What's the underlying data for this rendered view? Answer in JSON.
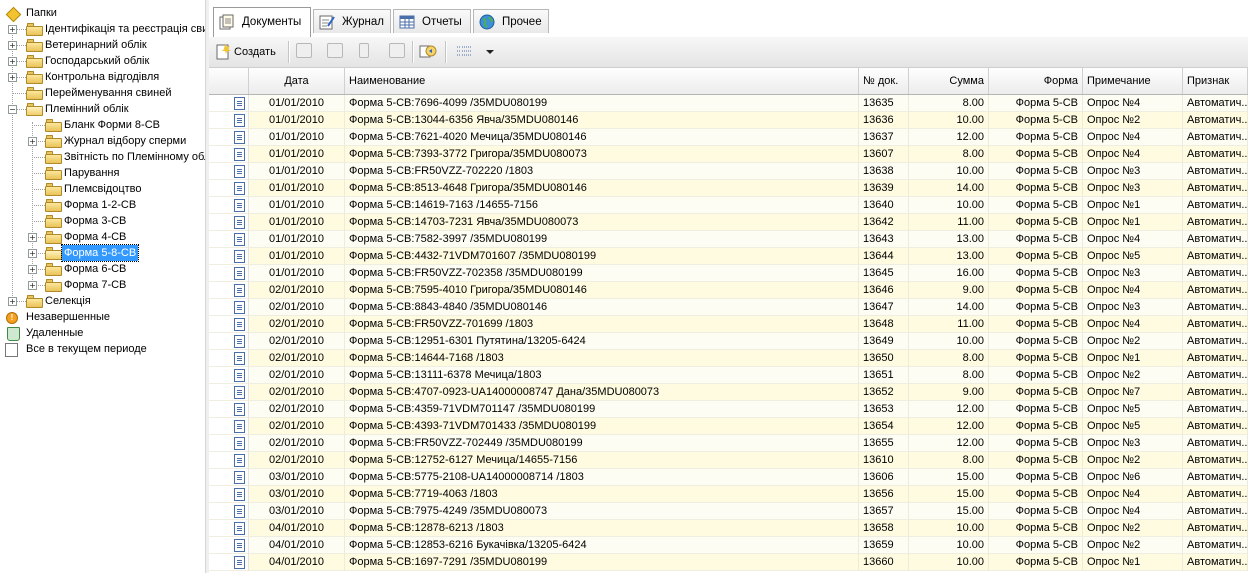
{
  "tree": {
    "root": "Папки",
    "items": [
      {
        "label": "Ідентифікація та реєстрація свиней",
        "level": 1,
        "exp": "+"
      },
      {
        "label": "Ветеринарний облік",
        "level": 1,
        "exp": "+"
      },
      {
        "label": "Господарський облік",
        "level": 1,
        "exp": "+"
      },
      {
        "label": "Контрольна відгодівля",
        "level": 1,
        "exp": "+"
      },
      {
        "label": "Перейменування свиней",
        "level": 1,
        "exp": ""
      },
      {
        "label": "Племінний облік",
        "level": 1,
        "exp": "-"
      },
      {
        "label": "Бланк Форми 8-СВ",
        "level": 2,
        "exp": ""
      },
      {
        "label": "Журнал відбору сперми",
        "level": 2,
        "exp": "+"
      },
      {
        "label": "Звітність по Племінному облік",
        "level": 2,
        "exp": ""
      },
      {
        "label": "Парування",
        "level": 2,
        "exp": ""
      },
      {
        "label": "Племсвідоцтво",
        "level": 2,
        "exp": ""
      },
      {
        "label": "Форма 1-2-СВ",
        "level": 2,
        "exp": ""
      },
      {
        "label": "Форма 3-СВ",
        "level": 2,
        "exp": ""
      },
      {
        "label": "Форма 4-СВ",
        "level": 2,
        "exp": "+"
      },
      {
        "label": "Форма 5-8-СВ",
        "level": 2,
        "exp": "+",
        "selected": true
      },
      {
        "label": "Форма 6-СВ",
        "level": 2,
        "exp": "+"
      },
      {
        "label": "Форма 7-СВ",
        "level": 2,
        "exp": "+"
      },
      {
        "label": "Селекція",
        "level": 1,
        "exp": "+"
      }
    ],
    "special": [
      {
        "label": "Незавершенные",
        "icon": "warning-icon"
      },
      {
        "label": "Удаленные",
        "icon": "recycle-bin-icon"
      },
      {
        "label": "Все в текущем периоде",
        "icon": "all-documents-icon"
      }
    ]
  },
  "tabs": [
    {
      "label": "Документы",
      "icon": "documents-icon",
      "active": true
    },
    {
      "label": "Журнал",
      "icon": "journal-icon",
      "active": false
    },
    {
      "label": "Отчеты",
      "icon": "reports-icon",
      "active": false
    },
    {
      "label": "Прочее",
      "icon": "globe-icon",
      "active": false
    }
  ],
  "toolbar": {
    "create_label": "Создать"
  },
  "grid": {
    "columns": [
      "",
      "Дата",
      "Наименование",
      "№ док.",
      "Сумма",
      "Форма",
      "Примечание",
      "Признак"
    ],
    "rows": [
      [
        "01/01/2010",
        "Форма 5-СВ:7696-4099      /35MDU080199",
        "13635",
        "8.00",
        "Форма 5-СВ",
        "Опрос №4",
        "Автоматич..."
      ],
      [
        "01/01/2010",
        "Форма 5-СВ:13044-6356 Явча/35MDU080146",
        "13636",
        "10.00",
        "Форма 5-СВ",
        "Опрос №2",
        "Автоматич..."
      ],
      [
        "01/01/2010",
        "Форма 5-СВ:7621-4020 Мечица/35MDU080146",
        "13637",
        "12.00",
        "Форма 5-СВ",
        "Опрос №4",
        "Автоматич..."
      ],
      [
        "01/01/2010",
        "Форма 5-СВ:7393-3772 Григора/35MDU080073",
        "13607",
        "8.00",
        "Форма 5-СВ",
        "Опрос №4",
        "Автоматич..."
      ],
      [
        "01/01/2010",
        "Форма 5-СВ:FR50VZZ-702220  /1803",
        "13638",
        "10.00",
        "Форма 5-СВ",
        "Опрос №3",
        "Автоматич..."
      ],
      [
        "01/01/2010",
        "Форма 5-СВ:8513-4648 Григора/35MDU080146",
        "13639",
        "14.00",
        "Форма 5-СВ",
        "Опрос №3",
        "Автоматич..."
      ],
      [
        "01/01/2010",
        "Форма 5-СВ:14619-7163      /14655-7156",
        "13640",
        "10.00",
        "Форма 5-СВ",
        "Опрос №1",
        "Автоматич..."
      ],
      [
        "01/01/2010",
        "Форма 5-СВ:14703-7231 Явча/35MDU080073",
        "13642",
        "11.00",
        "Форма 5-СВ",
        "Опрос №1",
        "Автоматич..."
      ],
      [
        "01/01/2010",
        "Форма 5-СВ:7582-3997 /35MDU080199",
        "13643",
        "13.00",
        "Форма 5-СВ",
        "Опрос №4",
        "Автоматич..."
      ],
      [
        "01/01/2010",
        "Форма 5-СВ:4432-71VDM701607  /35MDU080199",
        "13644",
        "13.00",
        "Форма 5-СВ",
        "Опрос №5",
        "Автоматич..."
      ],
      [
        "01/01/2010",
        "Форма 5-СВ:FR50VZZ-702358  /35MDU080199",
        "13645",
        "16.00",
        "Форма 5-СВ",
        "Опрос №3",
        "Автоматич..."
      ],
      [
        "02/01/2010",
        "Форма 5-СВ:7595-4010 Григора/35MDU080146",
        "13646",
        "9.00",
        "Форма 5-СВ",
        "Опрос №4",
        "Автоматич..."
      ],
      [
        "02/01/2010",
        "Форма 5-СВ:8843-4840      /35MDU080146",
        "13647",
        "14.00",
        "Форма 5-СВ",
        "Опрос №3",
        "Автоматич..."
      ],
      [
        "02/01/2010",
        "Форма 5-СВ:FR50VZZ-701699  /1803",
        "13648",
        "11.00",
        "Форма 5-СВ",
        "Опрос №4",
        "Автоматич..."
      ],
      [
        "02/01/2010",
        "Форма 5-СВ:12951-6301 Путятина/13205-6424",
        "13649",
        "10.00",
        "Форма 5-СВ",
        "Опрос №2",
        "Автоматич..."
      ],
      [
        "02/01/2010",
        "Форма 5-СВ:14644-7168      /1803",
        "13650",
        "8.00",
        "Форма 5-СВ",
        "Опрос №1",
        "Автоматич..."
      ],
      [
        "02/01/2010",
        "Форма 5-СВ:13111-6378 Мечица/1803",
        "13651",
        "8.00",
        "Форма 5-СВ",
        "Опрос №2",
        "Автоматич..."
      ],
      [
        "02/01/2010",
        "Форма 5-СВ:4707-0923-UA14000008747 Дана/35MDU080073",
        "13652",
        "9.00",
        "Форма 5-СВ",
        "Опрос №7",
        "Автоматич..."
      ],
      [
        "02/01/2010",
        "Форма 5-СВ:4359-71VDM701147  /35MDU080199",
        "13653",
        "12.00",
        "Форма 5-СВ",
        "Опрос №5",
        "Автоматич..."
      ],
      [
        "02/01/2010",
        "Форма 5-СВ:4393-71VDM701433  /35MDU080199",
        "13654",
        "12.00",
        "Форма 5-СВ",
        "Опрос №5",
        "Автоматич..."
      ],
      [
        "02/01/2010",
        "Форма 5-СВ:FR50VZZ-702449  /35MDU080199",
        "13655",
        "12.00",
        "Форма 5-СВ",
        "Опрос №3",
        "Автоматич..."
      ],
      [
        "02/01/2010",
        "Форма 5-СВ:12752-6127 Мечица/14655-7156",
        "13610",
        "8.00",
        "Форма 5-СВ",
        "Опрос №2",
        "Автоматич..."
      ],
      [
        "03/01/2010",
        "Форма 5-СВ:5775-2108-UA14000008714  /1803",
        "13606",
        "15.00",
        "Форма 5-СВ",
        "Опрос №6",
        "Автоматич..."
      ],
      [
        "03/01/2010",
        "Форма 5-СВ:7719-4063 /1803",
        "13656",
        "15.00",
        "Форма 5-СВ",
        "Опрос №4",
        "Автоматич..."
      ],
      [
        "03/01/2010",
        "Форма 5-СВ:7975-4249    /35MDU080073",
        "13657",
        "15.00",
        "Форма 5-СВ",
        "Опрос №4",
        "Автоматич..."
      ],
      [
        "04/01/2010",
        "Форма 5-СВ:12878-6213    /1803",
        "13658",
        "10.00",
        "Форма 5-СВ",
        "Опрос №2",
        "Автоматич..."
      ],
      [
        "04/01/2010",
        "Форма 5-СВ:12853-6216 Букачівка/13205-6424",
        "13659",
        "10.00",
        "Форма 5-СВ",
        "Опрос №2",
        "Автоматич..."
      ],
      [
        "04/01/2010",
        "Форма 5-СВ:1697-7291 /35MDU080199",
        "13660",
        "10.00",
        "Форма 5-СВ",
        "Опрос №1",
        "Автоматич..."
      ]
    ]
  }
}
